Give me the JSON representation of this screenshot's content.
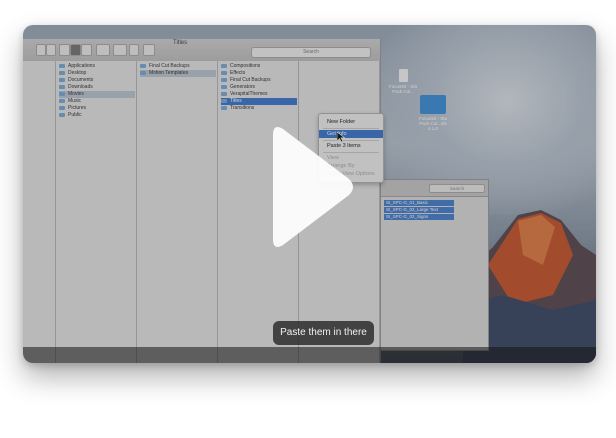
{
  "finder": {
    "window_title": "Titles",
    "search_placeholder": "Search",
    "col1": [
      "Applications",
      "Desktop",
      "Documents",
      "Downloads",
      "Movies",
      "Music",
      "Pictures",
      "Public"
    ],
    "col2": [
      "Final Cut Backups",
      "Motion Templates"
    ],
    "col3": [
      "Compositions",
      "Effects",
      "Final Cut Backups",
      "Generators",
      "VerapitalThemes",
      "Titles",
      "Transitions"
    ]
  },
  "context_menu": {
    "items": [
      "New Folder",
      "Get Info",
      "Paste 3 Items",
      "View",
      "Arrange By",
      "Show View Options"
    ]
  },
  "finder2": {
    "search_placeholder": "Search",
    "rows": [
      "SI_SPC-G_01_Basic",
      "SI_SPC-G_02_Large Text",
      "SI_SPC-G_02_Signs"
    ]
  },
  "desktop": {
    "icon1_label": "Focus93 - Sta Pack Col...",
    "icon2_label": "Focus93 - Sta Pack Col...ols 4.1.0"
  },
  "video": {
    "caption": "Paste them in there"
  },
  "colors": {
    "selection_blue": "#3d78cc",
    "caption_bg": "#2d2d2d"
  }
}
